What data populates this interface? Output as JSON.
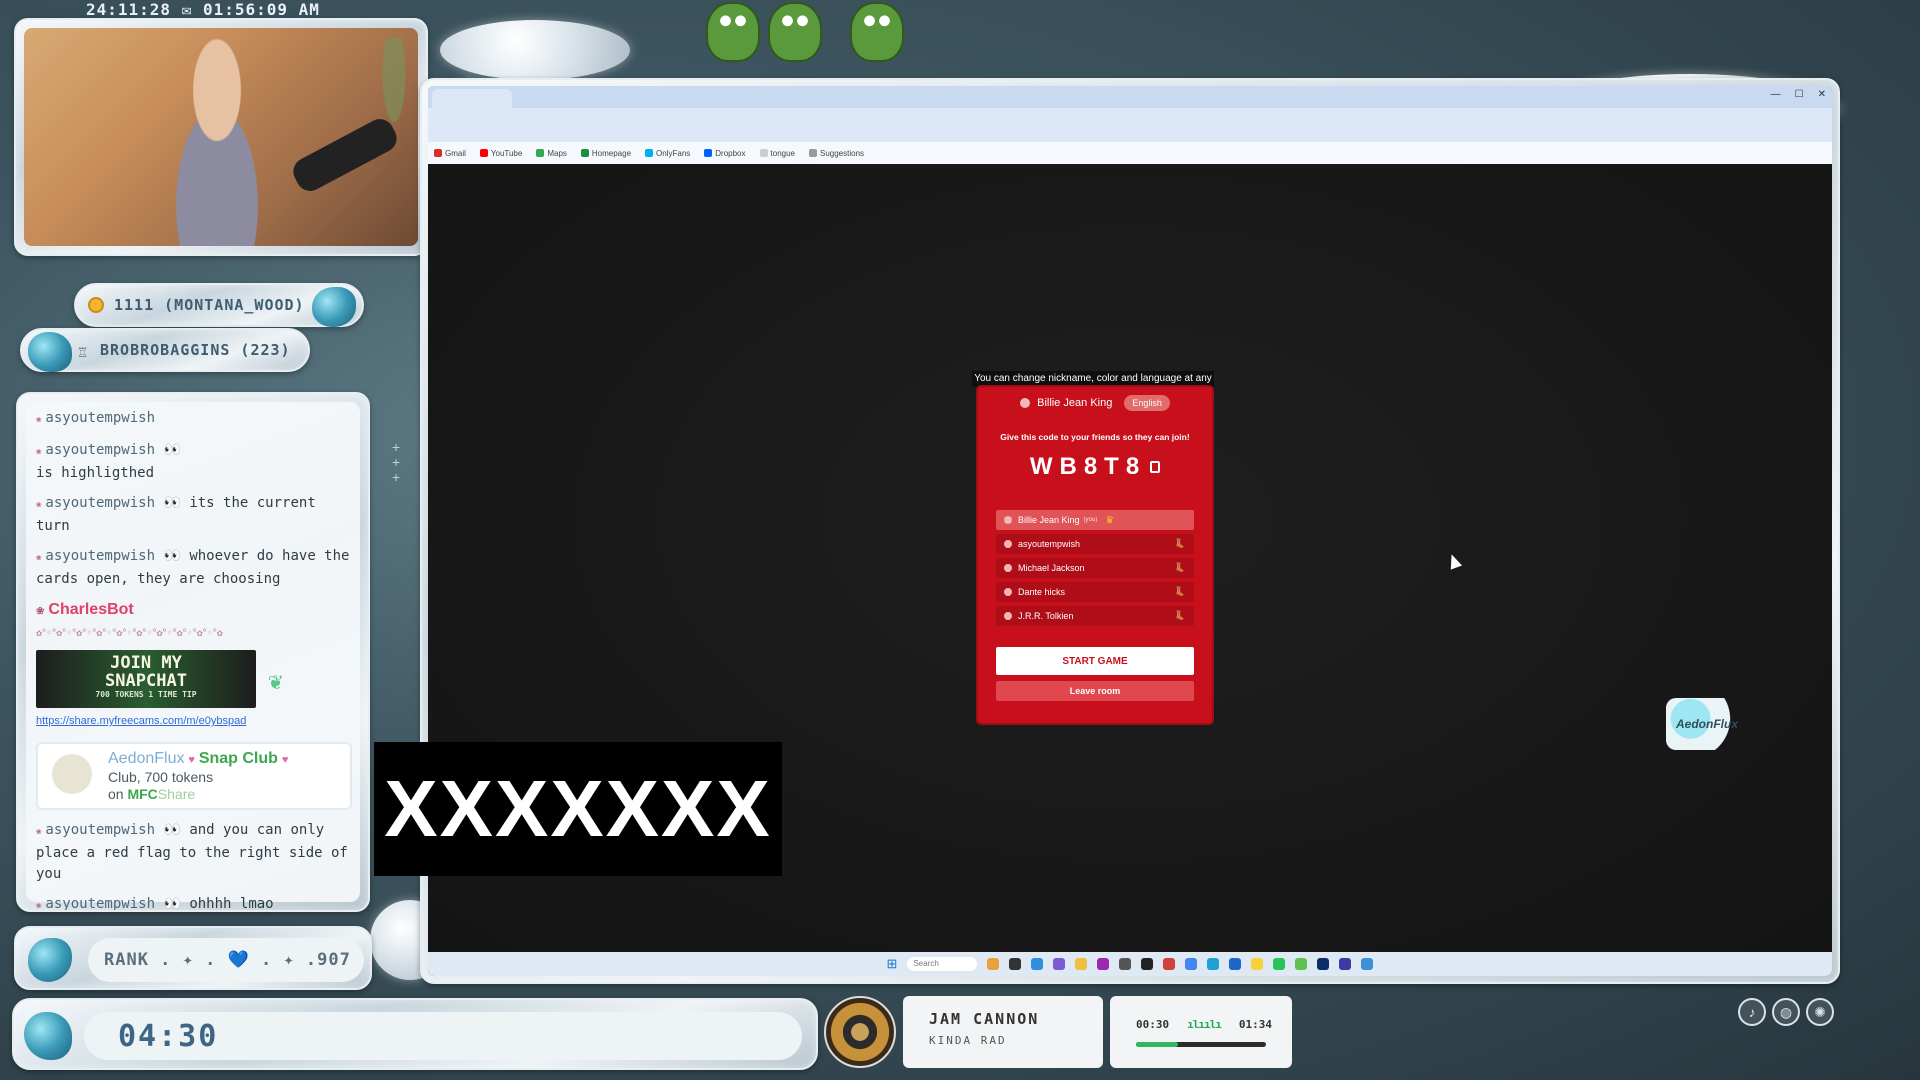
{
  "overlay": {
    "timestamp": "24:11:28 ✉ 01:56:09 AM",
    "goal_pill": "1111 (MONTANA_WOOD)",
    "top_pill": "BROBROBAGGINS (223)",
    "rank_text": "RANK . ✦ . 💙 . ✦ .907",
    "timer": "04:30",
    "stamp_color": "#e9f1f4",
    "accent": "#3a9bb8"
  },
  "chat": {
    "messages": [
      {
        "user": "asyoutempwish",
        "text": ""
      },
      {
        "user": "asyoutempwish",
        "text": "is highligthed"
      },
      {
        "user": "asyoutempwish",
        "text": "its the current turn"
      },
      {
        "user": "asyoutempwish",
        "text": "whoever do have the cards open, they are choosing"
      }
    ],
    "bot_name": "CharlesBot",
    "snap_title_1": "JOIN MY",
    "snap_title_2": "SNAPCHAT",
    "snap_sub": "700 TOKENS 1 TIME TIP",
    "snap_link": "https://share.myfreecams.com/m/e0ybspad",
    "tip_user": "AedonFlux",
    "tip_club": "Snap Club",
    "tip_line": "Club, 700 tokens",
    "tip_on": "on",
    "tip_mfc": "MFC",
    "tip_share": "Share",
    "later_messages": [
      {
        "user": "asyoutempwish",
        "text": "and you can only place a red flag to the right side of you"
      },
      {
        "user": "asyoutempwish",
        "text": "ohhhh lmao"
      }
    ]
  },
  "music": {
    "title": "JAM CANNON",
    "artist": "KINDA RAD",
    "elapsed": "00:30",
    "total": "01:34",
    "progress": 0.32,
    "fill_color": "#35b562"
  },
  "browser": {
    "bookmarks": [
      "Gmail",
      "YouTube",
      "Maps",
      "Homepage",
      "OnlyFans",
      "Dropbox",
      "tongue",
      "Suggestions"
    ],
    "taskbar_search": "Search"
  },
  "lobby": {
    "tip": "You can change nickname, color and language at any time!",
    "nickname": "Billie Jean King",
    "language": "English",
    "hint": "Give this code to your friends so they can join!",
    "code": "WB8T8",
    "players": [
      {
        "name": "Billie Jean King",
        "you": "(you)",
        "host": true
      },
      {
        "name": "asyoutempwish",
        "you": "",
        "host": false
      },
      {
        "name": "Michael Jackson",
        "you": "",
        "host": false
      },
      {
        "name": "Dante hicks",
        "you": "",
        "host": false
      },
      {
        "name": "J.R.R. Tolkien",
        "you": "",
        "host": false
      }
    ],
    "start_label": "START GAME",
    "leave_label": "Leave room",
    "bg_color": "#c8101c"
  },
  "censor_text": "XXXXXXX",
  "sticker_text": "AedonFlux"
}
